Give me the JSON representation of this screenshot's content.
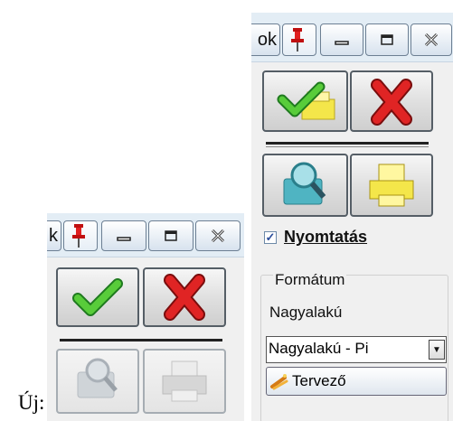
{
  "caption": "Új:",
  "old_panel": {
    "ok_fragment": "k",
    "pin_icon": "pushpin-icon",
    "minimize_icon": "minimize-icon",
    "restore_icon": "restore-icon",
    "close_icon": "close-icon",
    "actions": [
      {
        "name": "accept",
        "icon": "green-check-icon"
      },
      {
        "name": "cancel",
        "icon": "red-x-icon"
      },
      {
        "name": "preview",
        "icon": "print-preview-icon",
        "state": "disabled"
      },
      {
        "name": "print",
        "icon": "printer-icon",
        "state": "disabled"
      }
    ]
  },
  "new_panel": {
    "ok_fragment": "ok",
    "pin_icon": "pushpin-icon",
    "minimize_icon": "minimize-icon",
    "restore_icon": "restore-icon",
    "close_icon": "close-icon",
    "actions": [
      {
        "name": "accept-print",
        "icon": "check-printer-icon"
      },
      {
        "name": "cancel",
        "icon": "red-x-icon"
      },
      {
        "name": "preview",
        "icon": "print-preview-icon"
      },
      {
        "name": "print",
        "icon": "printer-icon"
      }
    ],
    "print_checkbox": {
      "label": "Nyomtatás",
      "checked": true
    },
    "format_group": {
      "title": "Formátum",
      "current_value": "Nagyalakú",
      "combo_value": "Nagyalakú - Pi",
      "designer_button": "Tervező"
    }
  },
  "colors": {
    "panel_bg": "#f0f0f0",
    "check_green": "#3cb43c",
    "x_red": "#d01818",
    "printer_yellow": "#f4e64a",
    "preview_teal": "#3aa7b5"
  }
}
